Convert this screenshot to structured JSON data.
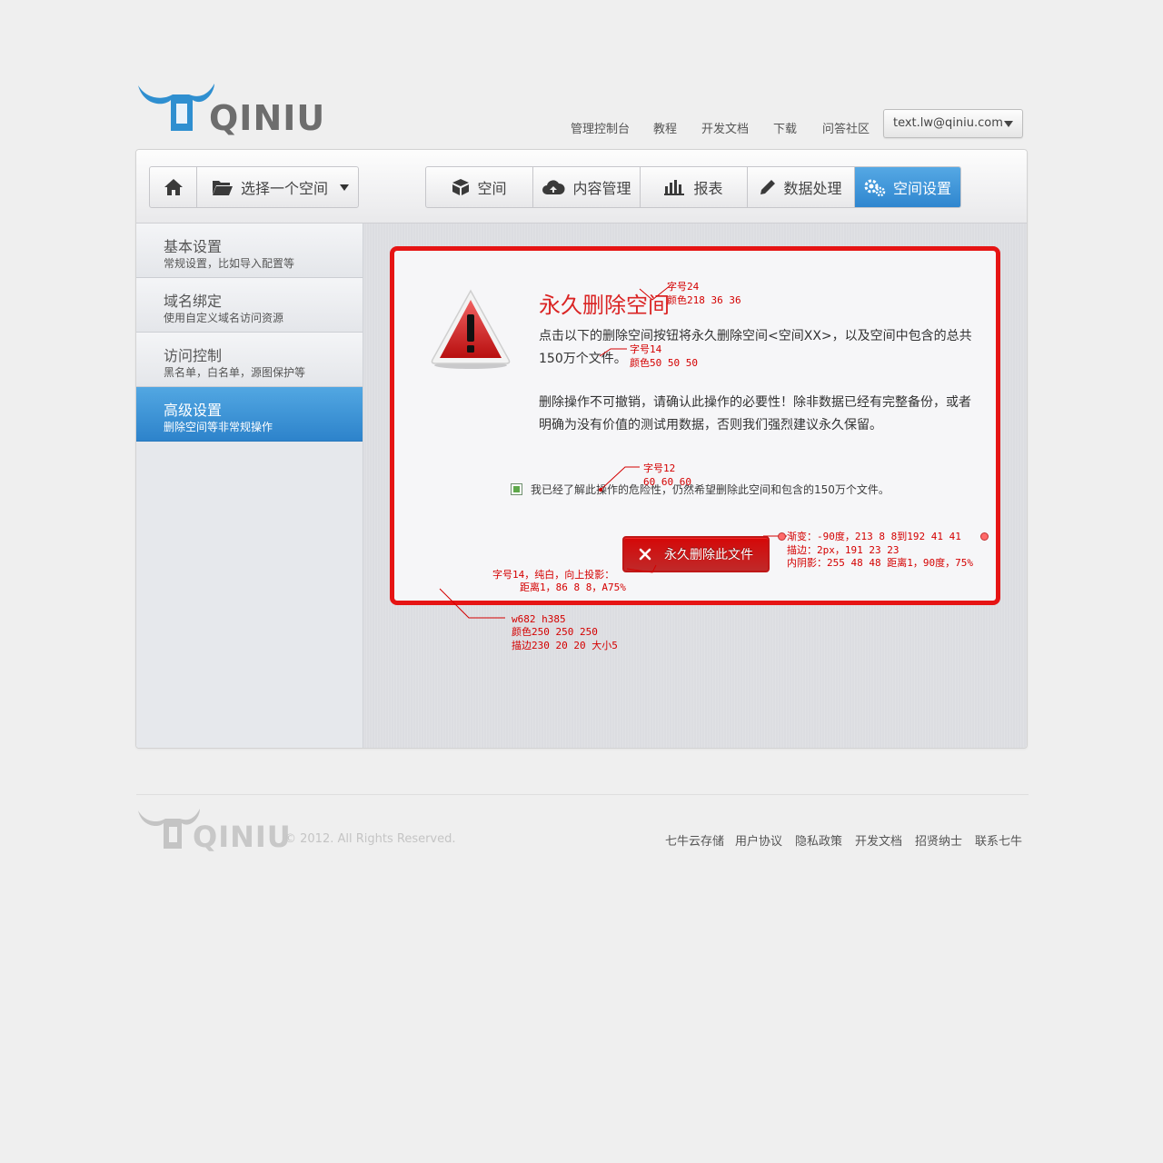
{
  "brand": {
    "name": "QINIU"
  },
  "topnav": {
    "items": [
      "管理控制台",
      "教程",
      "开发文档",
      "下载",
      "问答社区"
    ],
    "user_email": "text.lw@qiniu.com"
  },
  "toolbar": {
    "space_select": "选择一个空间",
    "tabs": [
      "空间",
      "内容管理",
      "报表",
      "数据处理",
      "空间设置"
    ]
  },
  "sidebar": {
    "items": [
      {
        "title": "基本设置",
        "subtitle": "常规设置，比如导入配置等"
      },
      {
        "title": "域名绑定",
        "subtitle": "使用自定义域名访问资源"
      },
      {
        "title": "访问控制",
        "subtitle": "黑名单，白名单，源图保护等"
      },
      {
        "title": "高级设置",
        "subtitle": "删除空间等非常规操作"
      }
    ]
  },
  "dialog": {
    "title": "永久删除空间",
    "p1": "点击以下的删除空间按钮将永久删除空间<空间XX>，以及空间中包含的总共150万个文件。",
    "p2": "删除操作不可撤销，请确认此操作的必要性！除非数据已经有完整备份，或者明确为没有价值的测试用数据，否则我们强烈建议永久保留。",
    "confirm_label": "我已经了解此操作的危险性，仍然希望删除此空间和包含的150万个文件。",
    "delete_button": "永久删除此文件"
  },
  "annotations": {
    "title_font": "字号24",
    "title_color": "颜色218 36 36",
    "body_font": "字号14",
    "body_color": "颜色50 50 50",
    "chk_font": "字号12",
    "chk_color": "60 60 60",
    "btn_gradient": "渐变：-90度，213 8 8到192 41 41",
    "btn_border": "描边：2px，191 23 23",
    "btn_shadow": "内阴影：255 48 48 距离1，90度，75%",
    "btn_text1": "字号14，纯白，向上投影：",
    "btn_text2": "距离1，86 8 8，A75%",
    "box_size": "w682 h385",
    "box_color": "颜色250 250 250",
    "box_border": "描边230 20 20 大小5"
  },
  "footer": {
    "copyright": "© 2012. All Rights Reserved.",
    "links": [
      "七牛云存储",
      "用户协议",
      "隐私政策",
      "开发文档",
      "招贤纳士",
      "联系七牛"
    ]
  },
  "colors": {
    "accent": "#2f86cf",
    "danger": "#e61414",
    "title": "#da2424"
  },
  "icons": [
    "home-icon",
    "folder-icon",
    "caret-down-icon",
    "box-icon",
    "cloud-icon",
    "bar-chart-icon",
    "pencil-icon",
    "gears-icon",
    "warning-icon",
    "close-icon"
  ]
}
